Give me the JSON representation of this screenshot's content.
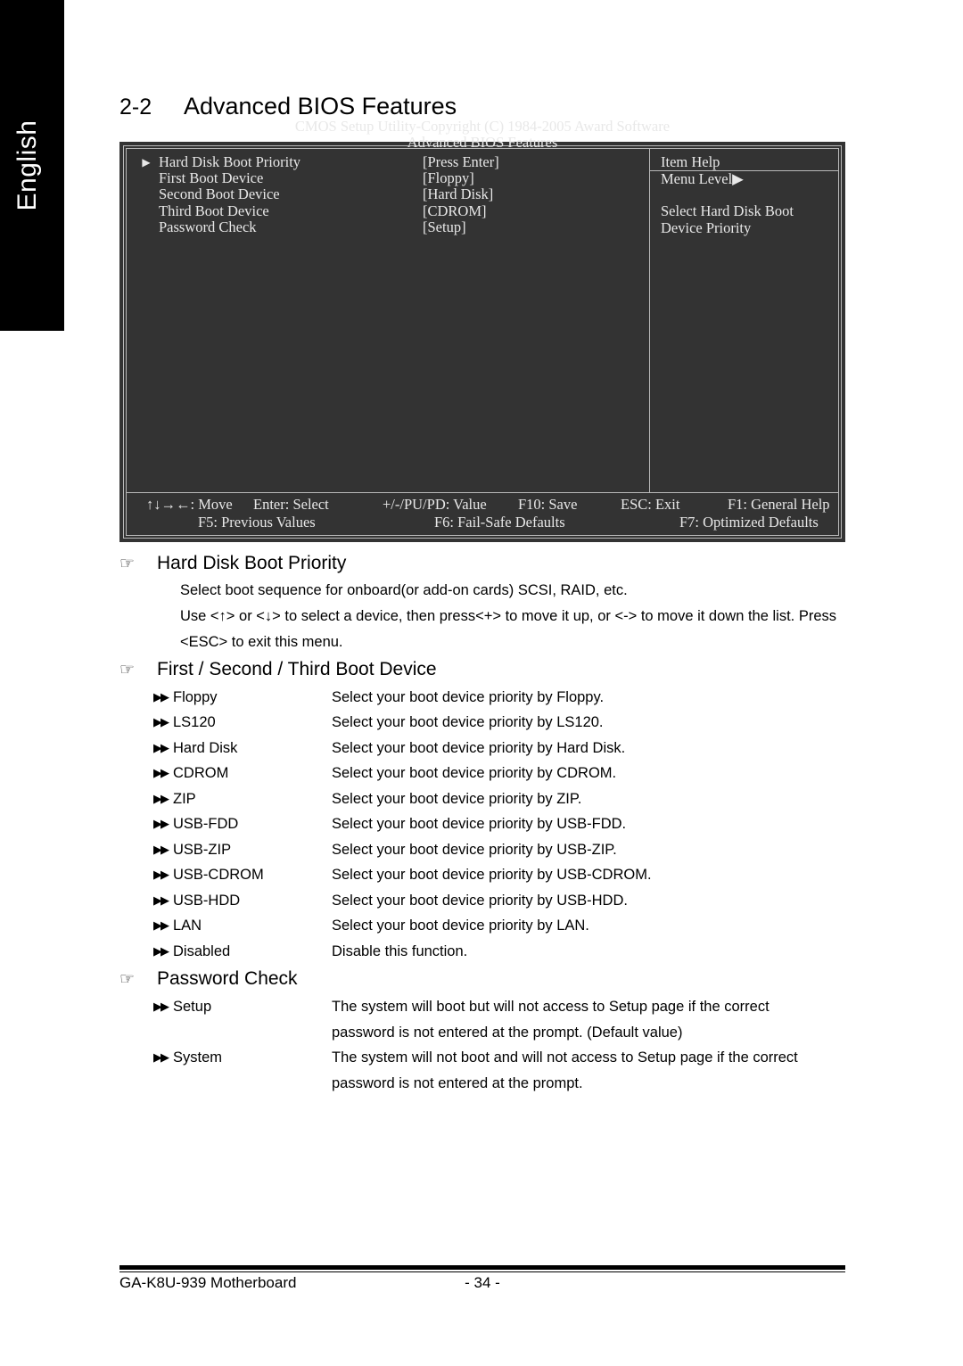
{
  "language_tab": {
    "label": "English"
  },
  "heading": {
    "number": "2-2",
    "title": "Advanced BIOS Features"
  },
  "bios": {
    "title_line1": "CMOS Setup Utility-Copyright (C) 1984-2005 Award Software",
    "title_line2": "Advanced BIOS Features",
    "selector_arrow": "▶",
    "items": [
      {
        "arrow": "▶",
        "label": "Hard Disk Boot Priority",
        "value": "[Press Enter]"
      },
      {
        "arrow": "",
        "label": "First Boot Device",
        "value": "[Floppy]"
      },
      {
        "arrow": "",
        "label": "Second Boot Device",
        "value": "[Hard Disk]"
      },
      {
        "arrow": "",
        "label": "Third Boot Device",
        "value": "[CDROM]"
      },
      {
        "arrow": "",
        "label": "Password Check",
        "value": "[Setup]"
      }
    ],
    "help": {
      "title": "Item Help",
      "menu_level": "Menu Level▶",
      "text_line1": "Select Hard Disk Boot",
      "text_line2": "Device Priority"
    },
    "footer": {
      "row1": [
        "↑↓→←: Move",
        "Enter: Select",
        "+/-/PU/PD: Value",
        "F10: Save",
        "ESC: Exit",
        "F1: General Help"
      ],
      "row2": [
        "F5: Previous Values",
        "F6: Fail-Safe Defaults",
        "F7: Optimized Defaults"
      ]
    }
  },
  "sections": {
    "hard_disk_boot_priority": {
      "icon": "☞",
      "title": "Hard Disk Boot Priority",
      "para1": "Select boot sequence for onboard(or add-on cards) SCSI, RAID, etc.",
      "para2_line1": "Use <↑> or <↓> to select a device, then press<+> to move it up, or <-> to move it down the list. Press",
      "para2_line2": "<ESC> to exit this menu."
    },
    "boot_device": {
      "icon": "☞",
      "title": "First / Second / Third Boot Device",
      "bullet": "▶▶",
      "options": [
        {
          "name": "Floppy",
          "desc": "Select your boot device priority by Floppy."
        },
        {
          "name": "LS120",
          "desc": "Select your boot device priority by LS120."
        },
        {
          "name": "Hard Disk",
          "desc": "Select your boot device priority by Hard Disk."
        },
        {
          "name": "CDROM",
          "desc": "Select your boot device priority by CDROM."
        },
        {
          "name": "ZIP",
          "desc": "Select your boot device priority by ZIP."
        },
        {
          "name": "USB-FDD",
          "desc": "Select your boot device priority by USB-FDD."
        },
        {
          "name": "USB-ZIP",
          "desc": "Select your boot device priority by USB-ZIP."
        },
        {
          "name": "USB-CDROM",
          "desc": "Select your boot device priority by USB-CDROM."
        },
        {
          "name": "USB-HDD",
          "desc": "Select your boot device priority by USB-HDD."
        },
        {
          "name": "LAN",
          "desc": "Select your boot device priority by LAN."
        },
        {
          "name": "Disabled",
          "desc": "Disable this function."
        }
      ]
    },
    "password_check": {
      "icon": "☞",
      "title": "Password Check",
      "bullet": "▶▶",
      "options": [
        {
          "name": "Setup",
          "desc_line1": "The system will boot but will not access to Setup page if the correct",
          "desc_line2": "password is not entered at the prompt. (Default value)"
        },
        {
          "name": "System",
          "desc_line1": "The system will not boot and will not access to Setup page if the correct",
          "desc_line2": "password is not entered at the prompt."
        }
      ]
    }
  },
  "page_footer": {
    "left": "GA-K8U-939 Motherboard",
    "center": "- 34 -"
  }
}
